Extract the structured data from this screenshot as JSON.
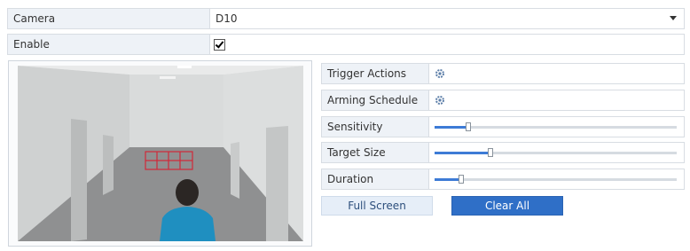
{
  "camera": {
    "label": "Camera",
    "value": "D10"
  },
  "enable": {
    "label": "Enable",
    "checked": true
  },
  "right_panel": {
    "trigger_actions": {
      "label": "Trigger Actions",
      "icon": "gear-icon"
    },
    "arming_schedule": {
      "label": "Arming Schedule",
      "icon": "gear-icon"
    },
    "sensitivity": {
      "label": "Sensitivity",
      "level": 0.14
    },
    "target_size": {
      "label": "Target Size",
      "level": 0.23
    },
    "duration": {
      "label": "Duration",
      "level": 0.11
    }
  },
  "buttons": {
    "full_screen": "Full Screen",
    "clear_all": "Clear All"
  },
  "colors": {
    "accent": "#2f6fc7",
    "detection_grid": "#d0293a",
    "label_bg": "#eef2f7"
  }
}
